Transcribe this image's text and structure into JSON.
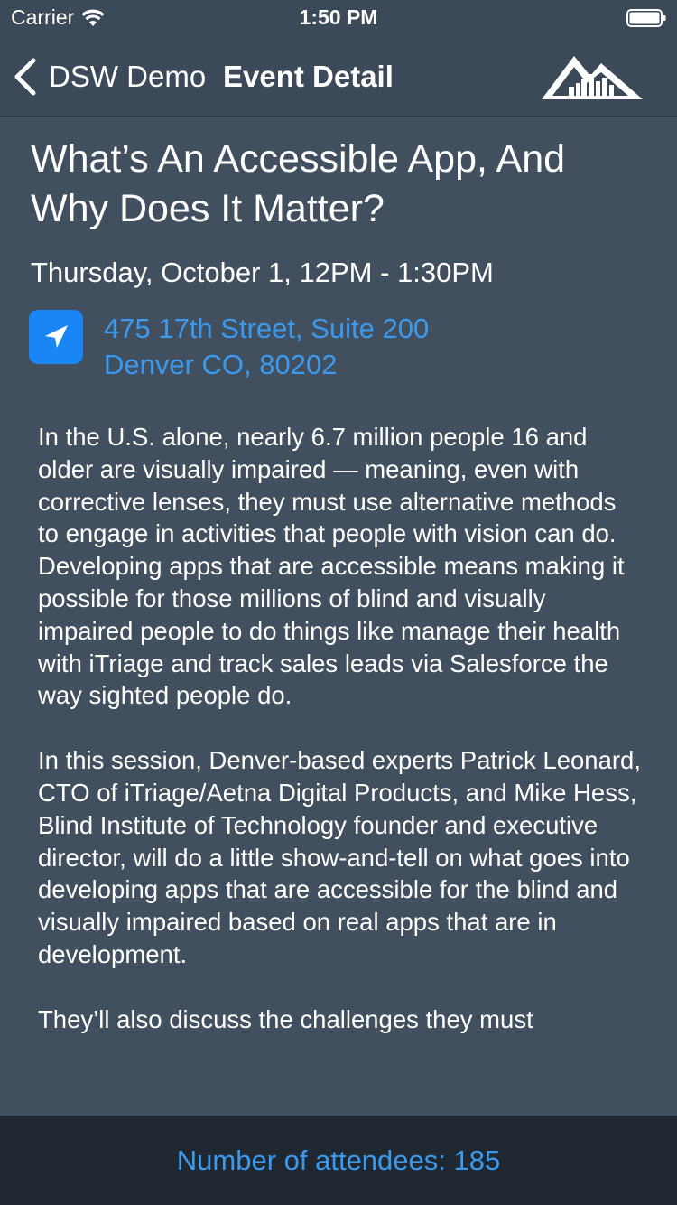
{
  "status_bar": {
    "carrier": "Carrier",
    "time": "1:50 PM"
  },
  "nav": {
    "back_label": "DSW Demo",
    "title": "Event Detail",
    "logo_icon": "mountain-city-logo-icon"
  },
  "event": {
    "title": "What’s An Accessible App, And Why Does It Matter?",
    "date": "Thursday, October 1, 12PM - 1:30PM",
    "address_line1": "475 17th Street, Suite 200",
    "address_line2": "Denver CO, 80202",
    "description": [
      "In the U.S. alone, nearly 6.7 million people 16 and older are visually impaired — meaning, even with corrective lenses, they must use alternative methods to engage in activities that people with vision can do. Developing apps that are accessible means making it possible for those millions of blind and visually impaired people to do things like manage their health with iTriage and track sales leads via Salesforce the way sighted people do.",
      "In this session, Denver-based experts Patrick Leonard, CTO of iTriage/Aetna Digital Products, and Mike Hess, Blind Institute of Technology founder and executive director, will do a little show-and-tell on what goes into developing apps that are accessible for the blind and visually impaired based on real apps that are in development.",
      "They’ll also discuss the challenges they must"
    ]
  },
  "footer": {
    "attendees_label": "Number of attendees: 185"
  },
  "colors": {
    "background": "#414f5e",
    "nav_background": "#3b4959",
    "accent": "#3c9aee",
    "location_icon": "#1a86f5",
    "footer_background": "#1f2831"
  }
}
